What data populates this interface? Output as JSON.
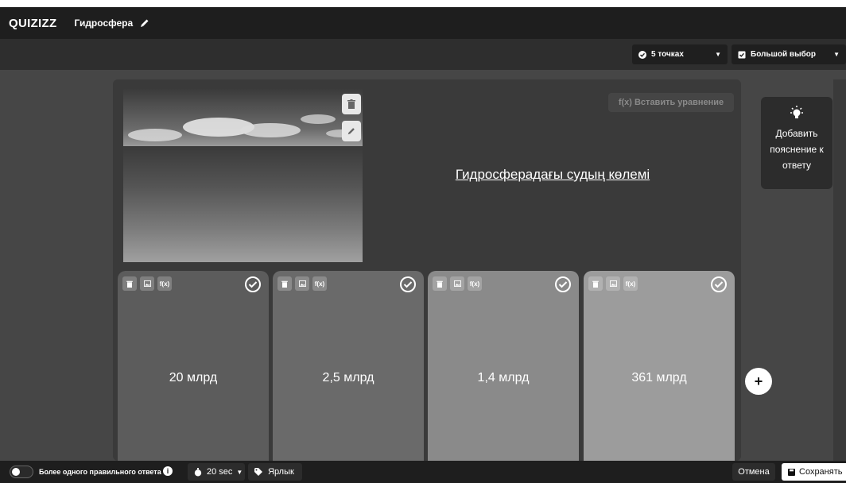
{
  "header": {
    "logo": "QUIZIZZ",
    "quiz_title": "Гидросфера"
  },
  "toolbar": {
    "points_label": "5 точках",
    "question_type_label": "Большой выбор"
  },
  "question": {
    "equation_button_label": "f(x) Вставить уравнение",
    "text": "Гидросферадағы судың көлемі"
  },
  "explanation": {
    "label": "Добавить пояснение к ответу"
  },
  "answers": [
    {
      "text": "20 млрд"
    },
    {
      "text": "2,5 млрд"
    },
    {
      "text": "1,4 млрд"
    },
    {
      "text": "361 млрд"
    }
  ],
  "answer_tools": {
    "equation_label": "f(x)"
  },
  "add_answer_label": "+",
  "footer": {
    "multiple_correct_label": "Более одного правильного ответа",
    "timer_label": "20 sec",
    "tag_label": "Ярлык",
    "cancel_label": "Отмена",
    "save_label": "Сохранять"
  },
  "icons": {
    "pencil": "pencil-icon",
    "check_circle": "check-circle-icon",
    "checkbox": "checkbox-icon",
    "trash": "trash-icon",
    "image": "image-icon",
    "bulb": "lightbulb-icon",
    "info": "info-icon",
    "stopwatch": "stopwatch-icon",
    "tag": "tag-icon",
    "save": "save-icon"
  }
}
